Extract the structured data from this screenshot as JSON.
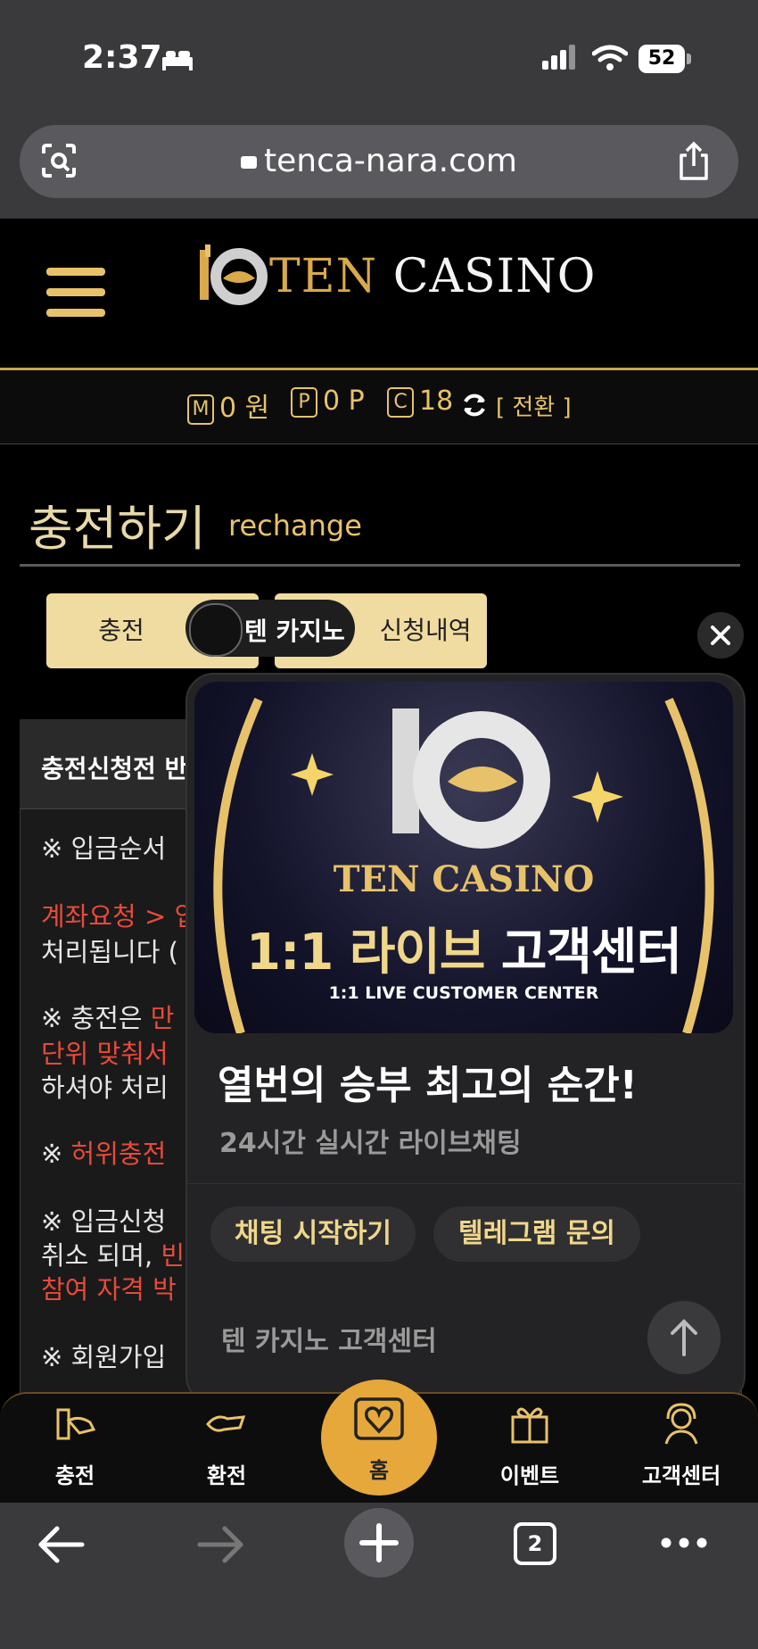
{
  "status_bar": {
    "time": "2:37",
    "battery": "52"
  },
  "browser": {
    "url": "tenca-nara.com",
    "tab_count": "2"
  },
  "header": {
    "logo_ten": "TEN",
    "logo_casino": "CASINO"
  },
  "balances": {
    "m_letter": "M",
    "m_value": "0 원",
    "p_letter": "P",
    "p_value": "0 P",
    "c_letter": "C",
    "c_value": "18",
    "switch_label": "[ 전환 ]"
  },
  "page": {
    "title": "충전하기",
    "subtitle": "rechange",
    "tab_charge": "충전",
    "tab_history": "신청내역",
    "chip_label": "텐 카지노"
  },
  "notice": {
    "header": "충전신청전 반",
    "lines": [
      {
        "a": "※ 입금순서",
        "b": "",
        "c": ""
      },
      {
        "a": "",
        "b": "계좌요청 > 입",
        "c": ""
      },
      {
        "a": "처리됩니다 (",
        "b": "",
        "c": ""
      },
      {
        "a": "※ 충전은 ",
        "b": "만",
        "c": ""
      },
      {
        "a": "",
        "b": "단위 맞춰서 ",
        "c": ""
      },
      {
        "a": "하셔야 처리 ",
        "b": "",
        "c": ""
      },
      {
        "a": "※ ",
        "b": "허위충전 ",
        "c": ""
      },
      {
        "a": "※ 입금신청 ",
        "b": "",
        "c": ""
      },
      {
        "a": "취소 되며, ",
        "b": "빈",
        "c": ""
      },
      {
        "a": "",
        "b": "참여 자격 박",
        "c": ""
      },
      {
        "a": "※ 회원가입 ",
        "b": "",
        "c": ""
      }
    ]
  },
  "popup": {
    "banner_brand": "TEN CASINO",
    "banner_headline_gold": "1:1 라이브",
    "banner_headline_white": "고객센터",
    "banner_sub": "1:1 LIVE CUSTOMER CENTER",
    "title": "열번의 승부 최고의 순간!",
    "subtitle": "24시간 실시간 라이브채팅",
    "btn_chat": "채팅 시작하기",
    "btn_telegram": "텔레그램 문의",
    "footer": "텐 카지노 고객센터"
  },
  "bottom_nav": {
    "charge": "충전",
    "exchange": "환전",
    "home": "홈",
    "event": "이벤트",
    "support": "고객센터"
  },
  "colors": {
    "gold": "#e8c26a",
    "accent_orange": "#e6a83a",
    "red_text": "#e84a3a"
  }
}
